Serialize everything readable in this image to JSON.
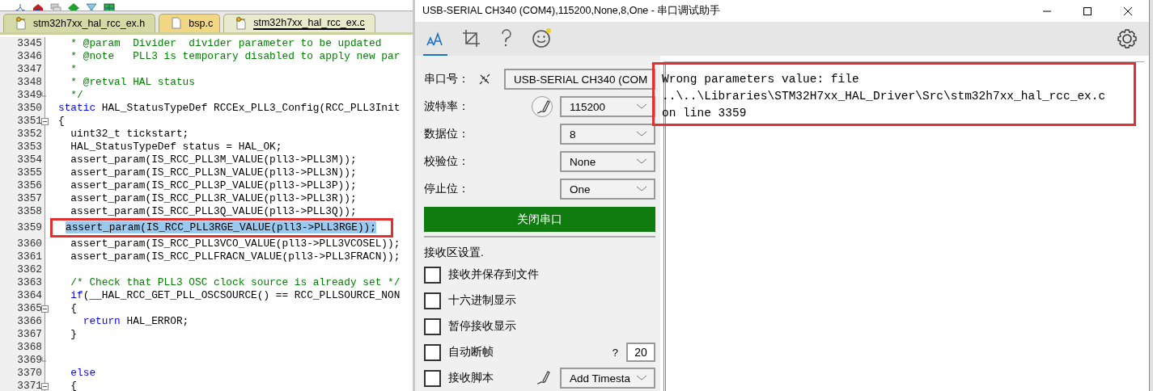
{
  "editor": {
    "tabs": [
      {
        "label": "stm32h7xx_hal_rcc_ex.h",
        "kind": "locked",
        "selected": false
      },
      {
        "label": "bsp.c",
        "kind": "plain",
        "selected": false
      },
      {
        "label": "stm32h7xx_hal_rcc_ex.c",
        "kind": "locked",
        "selected": true
      }
    ],
    "lines": [
      {
        "number": "3345",
        "selected": false,
        "segments": [
          {
            "kind": "comment",
            "text": "  * @param  Divider  divider parameter to be updated"
          }
        ]
      },
      {
        "number": "3346",
        "selected": false,
        "segments": [
          {
            "kind": "comment",
            "text": "  * @note   PLL3 is temporary disabled to apply new par"
          }
        ]
      },
      {
        "number": "3347",
        "selected": false,
        "segments": [
          {
            "kind": "comment",
            "text": "  *"
          }
        ]
      },
      {
        "number": "3348",
        "selected": false,
        "segments": [
          {
            "kind": "comment",
            "text": "  * @retval HAL status"
          }
        ]
      },
      {
        "number": "3349",
        "selected": false,
        "block_end": true,
        "segments": [
          {
            "kind": "comment",
            "text": "  */"
          }
        ]
      },
      {
        "number": "3350",
        "selected": false,
        "segments": [
          {
            "kind": "keyword",
            "text": "static"
          },
          {
            "kind": "plain",
            "text": " HAL_StatusTypeDef RCCEx_PLL3_Config(RCC_PLL3Init"
          }
        ]
      },
      {
        "number": "3351",
        "selected": false,
        "collapsible": true,
        "segments": [
          {
            "kind": "plain",
            "text": "{"
          }
        ]
      },
      {
        "number": "3352",
        "selected": false,
        "segments": [
          {
            "kind": "plain",
            "text": "  uint32_t tickstart;"
          }
        ]
      },
      {
        "number": "3353",
        "selected": false,
        "segments": [
          {
            "kind": "plain",
            "text": "  HAL_StatusTypeDef status = HAL_OK;"
          }
        ]
      },
      {
        "number": "3354",
        "selected": false,
        "segments": [
          {
            "kind": "plain",
            "text": "  assert_param(IS_RCC_PLL3M_VALUE(pll3->PLL3M));"
          }
        ]
      },
      {
        "number": "3355",
        "selected": false,
        "segments": [
          {
            "kind": "plain",
            "text": "  assert_param(IS_RCC_PLL3N_VALUE(pll3->PLL3N));"
          }
        ]
      },
      {
        "number": "3356",
        "selected": false,
        "segments": [
          {
            "kind": "plain",
            "text": "  assert_param(IS_RCC_PLL3P_VALUE(pll3->PLL3P));"
          }
        ]
      },
      {
        "number": "3357",
        "selected": false,
        "segments": [
          {
            "kind": "plain",
            "text": "  assert_param(IS_RCC_PLL3R_VALUE(pll3->PLL3R));"
          }
        ]
      },
      {
        "number": "3358",
        "selected": false,
        "segments": [
          {
            "kind": "plain",
            "text": "  assert_param(IS_RCC_PLL3Q_VALUE(pll3->PLL3Q));"
          }
        ]
      },
      {
        "number": "3359",
        "selected": true,
        "outlined": true,
        "segments": [
          {
            "kind": "plain",
            "text": "assert_param(IS_RCC_PLL3RGE_VALUE(pll3->PLL3RGE));"
          }
        ]
      },
      {
        "number": "3360",
        "selected": false,
        "segments": [
          {
            "kind": "plain",
            "text": "  assert_param(IS_RCC_PLL3VCO_VALUE(pll3->PLL3VCOSEL));"
          }
        ]
      },
      {
        "number": "3361",
        "selected": false,
        "segments": [
          {
            "kind": "plain",
            "text": "  assert_param(IS_RCC_PLLFRACN_VALUE(pll3->PLL3FRACN));"
          }
        ]
      },
      {
        "number": "3362",
        "selected": false
      },
      {
        "number": "3363",
        "selected": false,
        "segments": [
          {
            "kind": "comment",
            "text": "  /* Check that PLL3 OSC clock source is already set */"
          }
        ]
      },
      {
        "number": "3364",
        "selected": false,
        "segments": [
          {
            "kind": "keyword",
            "text": "  if"
          },
          {
            "kind": "plain",
            "text": "(__HAL_RCC_GET_PLL_OSCSOURCE() == RCC_PLLSOURCE_NON"
          }
        ]
      },
      {
        "number": "3365",
        "selected": false,
        "collapsible": true,
        "segments": [
          {
            "kind": "plain",
            "text": "  {"
          }
        ]
      },
      {
        "number": "3366",
        "selected": false,
        "segments": [
          {
            "kind": "keyword",
            "text": "    return"
          },
          {
            "kind": "plain",
            "text": " HAL_ERROR;"
          }
        ]
      },
      {
        "number": "3367",
        "selected": false,
        "segments": [
          {
            "kind": "plain",
            "text": "  }"
          }
        ]
      },
      {
        "number": "3368",
        "selected": false
      },
      {
        "number": "3369",
        "selected": false,
        "block_end": true
      },
      {
        "number": "3370",
        "selected": false,
        "segments": [
          {
            "kind": "keyword",
            "text": "  else"
          }
        ]
      },
      {
        "number": "3371",
        "selected": false,
        "collapsible": true,
        "segments": [
          {
            "kind": "plain",
            "text": "  {"
          }
        ]
      }
    ]
  },
  "serial": {
    "title": "USB-SERIAL CH340 (COM4),115200,None,8,One - 串口调试助手",
    "toolbar": [
      {
        "kind": "font",
        "selected": true
      },
      {
        "kind": "crop",
        "selected": false
      },
      {
        "kind": "help",
        "selected": false
      },
      {
        "kind": "smiley",
        "selected": false
      }
    ],
    "settings": [
      {
        "label": "串口号：",
        "kind": "port",
        "value": "USB-SERIAL CH340 (COM"
      },
      {
        "label": "波特率：",
        "kind": "baud",
        "value": "115200"
      },
      {
        "label": "数据位：",
        "kind": "dropdown",
        "value": "8"
      },
      {
        "label": "校验位：",
        "kind": "dropdown",
        "value": "None"
      },
      {
        "label": "停止位：",
        "kind": "dropdown",
        "value": "One"
      }
    ],
    "button": "关闭串口",
    "receive": {
      "title": "接收区设置.",
      "options": [
        {
          "label": "接收并保存到文件",
          "checked": false
        },
        {
          "label": "十六进制显示",
          "checked": false
        },
        {
          "label": "暂停接收显示",
          "checked": false
        },
        {
          "label": "自动断帧",
          "checked": false,
          "hint": "?",
          "value": "20"
        },
        {
          "label": "接收脚本",
          "checked": false,
          "dropdown": "Add Timesta"
        }
      ]
    },
    "output": {
      "outlined": true,
      "lines": [
        "Wrong parameters value: file",
        "..\\..\\Libraries\\STM32H7xx_HAL_Driver\\Src\\stm32h7xx_hal_rcc_ex.c",
        "on line 3359"
      ]
    }
  }
}
